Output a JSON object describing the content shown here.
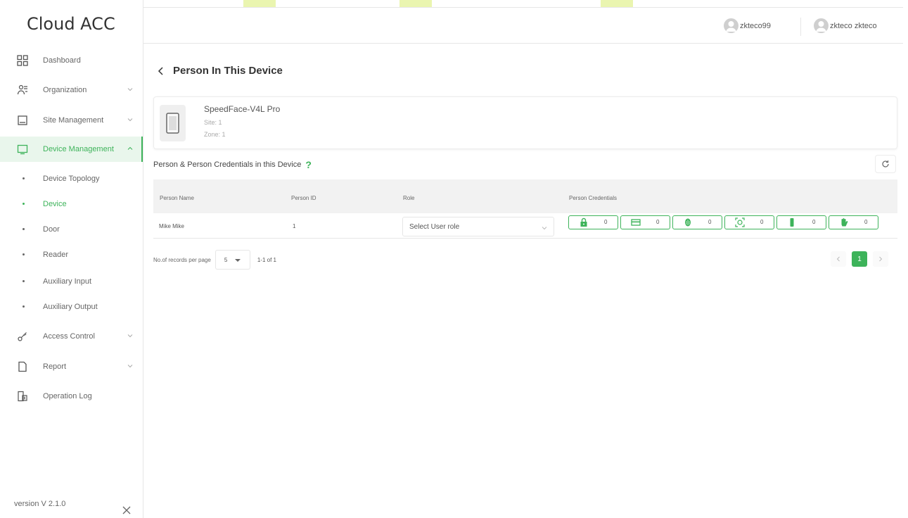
{
  "app": {
    "title": "Cloud ACC",
    "version": "version V 2.1.0",
    "accent_color": "#3db35a"
  },
  "header": {
    "users": [
      {
        "name": "zkteco99",
        "icon": "user-avatar-icon"
      },
      {
        "name": "zkteco zkteco",
        "icon": "user-avatar-icon"
      }
    ]
  },
  "sidebar": {
    "items": [
      {
        "label": "Dashboard",
        "icon": "dashboard-grid-icon",
        "expandable": false
      },
      {
        "label": "Organization",
        "icon": "organization-icon",
        "expandable": true
      },
      {
        "label": "Site Management",
        "icon": "site-icon",
        "expandable": true
      },
      {
        "label": "Device Management",
        "icon": "monitor-icon",
        "expandable": true,
        "active": true
      },
      {
        "label": "Access Control",
        "icon": "key-icon",
        "expandable": true
      },
      {
        "label": "Report",
        "icon": "document-icon",
        "expandable": true
      },
      {
        "label": "Operation Log",
        "icon": "log-icon",
        "expandable": false
      }
    ],
    "subitems": [
      {
        "label": "Device Topology"
      },
      {
        "label": "Device",
        "active": true
      },
      {
        "label": "Door"
      },
      {
        "label": "Reader"
      },
      {
        "label": "Auxiliary Input"
      },
      {
        "label": "Auxiliary Output"
      }
    ]
  },
  "page": {
    "title": "Person In This Device",
    "device": {
      "name": "SpeedFace-V4L Pro",
      "site": "Site: 1",
      "zone": "Zone: 1"
    },
    "section_title": "Person & Person Credentials in this Device",
    "help_mark": "?"
  },
  "table": {
    "columns": [
      "Person Name",
      "Person ID",
      "Role",
      "Person Credentials"
    ],
    "rows": [
      {
        "name": "Mike Mike",
        "id": "1",
        "role_placeholder": "Select User role",
        "credentials": [
          {
            "type": "password",
            "icon": "lock-icon",
            "count": "0"
          },
          {
            "type": "card",
            "icon": "card-icon",
            "count": "0"
          },
          {
            "type": "fingerprint",
            "icon": "fingerprint-icon",
            "count": "0"
          },
          {
            "type": "face",
            "icon": "face-icon",
            "count": "0"
          },
          {
            "type": "palm",
            "icon": "palm-vein-icon",
            "count": "0"
          },
          {
            "type": "visible-palm",
            "icon": "palm-icon",
            "count": "0"
          }
        ]
      }
    ]
  },
  "pagination": {
    "per_page_label": "No.of records per page",
    "per_page_value": "5",
    "range": "1-1 of 1",
    "current_page": "1"
  }
}
